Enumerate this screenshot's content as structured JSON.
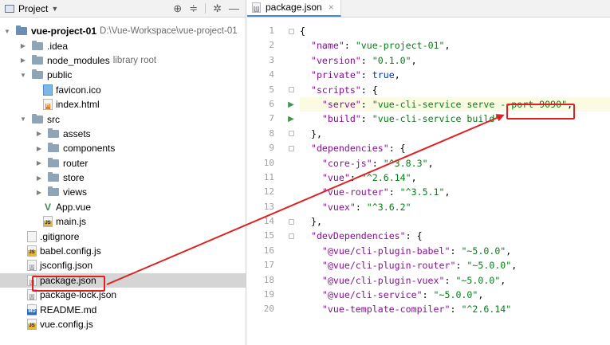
{
  "project_panel": {
    "title": "Project",
    "tools": [
      "target-icon",
      "collapse-all-icon",
      "gear-icon",
      "minimize-icon"
    ]
  },
  "tree": [
    {
      "label": "vue-project-01",
      "path": "D:\\Vue-Workspace\\vue-project-01",
      "type": "root",
      "depth": 0,
      "expanded": true,
      "bold": true
    },
    {
      "label": ".idea",
      "type": "folder",
      "depth": 1,
      "expanded": false
    },
    {
      "label": "node_modules",
      "path": "library root",
      "type": "folder",
      "depth": 1,
      "expanded": false
    },
    {
      "label": "public",
      "type": "folder",
      "depth": 1,
      "expanded": true
    },
    {
      "label": "favicon.ico",
      "type": "ico",
      "depth": 2
    },
    {
      "label": "index.html",
      "type": "html",
      "depth": 2
    },
    {
      "label": "src",
      "type": "folder",
      "depth": 1,
      "expanded": true
    },
    {
      "label": "assets",
      "type": "folder",
      "depth": 2,
      "expanded": false
    },
    {
      "label": "components",
      "type": "folder",
      "depth": 2,
      "expanded": false
    },
    {
      "label": "router",
      "type": "folder",
      "depth": 2,
      "expanded": false
    },
    {
      "label": "store",
      "type": "folder",
      "depth": 2,
      "expanded": false
    },
    {
      "label": "views",
      "type": "folder",
      "depth": 2,
      "expanded": false
    },
    {
      "label": "App.vue",
      "type": "vue",
      "depth": 2
    },
    {
      "label": "main.js",
      "type": "js",
      "depth": 2
    },
    {
      "label": ".gitignore",
      "type": "cfg",
      "depth": 1
    },
    {
      "label": "babel.config.js",
      "type": "js",
      "depth": 1
    },
    {
      "label": "jsconfig.json",
      "type": "json",
      "depth": 1
    },
    {
      "label": "package.json",
      "type": "json",
      "depth": 1,
      "selected": true
    },
    {
      "label": "package-lock.json",
      "type": "json",
      "depth": 1
    },
    {
      "label": "README.md",
      "type": "md",
      "depth": 1
    },
    {
      "label": "vue.config.js",
      "type": "js",
      "depth": 1
    }
  ],
  "editor": {
    "tab_label": "package.json",
    "lines": [
      [
        [
          "p",
          "{"
        ]
      ],
      [
        [
          "p",
          "  "
        ],
        [
          "k",
          "\"name\""
        ],
        [
          "p",
          ": "
        ],
        [
          "s",
          "\"vue-project-01\""
        ],
        [
          "p",
          ","
        ]
      ],
      [
        [
          "p",
          "  "
        ],
        [
          "k",
          "\"version\""
        ],
        [
          "p",
          ": "
        ],
        [
          "s",
          "\"0.1.0\""
        ],
        [
          "p",
          ","
        ]
      ],
      [
        [
          "p",
          "  "
        ],
        [
          "k",
          "\"private\""
        ],
        [
          "p",
          ": "
        ],
        [
          "b",
          "true"
        ],
        [
          "p",
          ","
        ]
      ],
      [
        [
          "p",
          "  "
        ],
        [
          "k",
          "\"scripts\""
        ],
        [
          "p",
          ": {"
        ]
      ],
      [
        [
          "p",
          "    "
        ],
        [
          "k",
          "\"serve\""
        ],
        [
          "p",
          ": "
        ],
        [
          "s",
          "\"vue-cli-service serve --port 9090\""
        ],
        [
          "p",
          ","
        ]
      ],
      [
        [
          "p",
          "    "
        ],
        [
          "k",
          "\"build\""
        ],
        [
          "p",
          ": "
        ],
        [
          "s",
          "\"vue-cli-service build\""
        ]
      ],
      [
        [
          "p",
          "  },"
        ]
      ],
      [
        [
          "p",
          "  "
        ],
        [
          "k",
          "\"dependencies\""
        ],
        [
          "p",
          ": {"
        ]
      ],
      [
        [
          "p",
          "    "
        ],
        [
          "k",
          "\"core-js\""
        ],
        [
          "p",
          ": "
        ],
        [
          "s",
          "\"^3.8.3\""
        ],
        [
          "p",
          ","
        ]
      ],
      [
        [
          "p",
          "    "
        ],
        [
          "k",
          "\"vue\""
        ],
        [
          "p",
          ": "
        ],
        [
          "s",
          "\"^2.6.14\""
        ],
        [
          "p",
          ","
        ]
      ],
      [
        [
          "p",
          "    "
        ],
        [
          "k",
          "\"vue-router\""
        ],
        [
          "p",
          ": "
        ],
        [
          "s",
          "\"^3.5.1\""
        ],
        [
          "p",
          ","
        ]
      ],
      [
        [
          "p",
          "    "
        ],
        [
          "k",
          "\"vuex\""
        ],
        [
          "p",
          ": "
        ],
        [
          "s",
          "\"^3.6.2\""
        ]
      ],
      [
        [
          "p",
          "  },"
        ]
      ],
      [
        [
          "p",
          "  "
        ],
        [
          "k",
          "\"devDependencies\""
        ],
        [
          "p",
          ": {"
        ]
      ],
      [
        [
          "p",
          "    "
        ],
        [
          "k",
          "\"@vue/cli-plugin-babel\""
        ],
        [
          "p",
          ": "
        ],
        [
          "s",
          "\"~5.0.0\""
        ],
        [
          "p",
          ","
        ]
      ],
      [
        [
          "p",
          "    "
        ],
        [
          "k",
          "\"@vue/cli-plugin-router\""
        ],
        [
          "p",
          ": "
        ],
        [
          "s",
          "\"~5.0.0\""
        ],
        [
          "p",
          ","
        ]
      ],
      [
        [
          "p",
          "    "
        ],
        [
          "k",
          "\"@vue/cli-plugin-vuex\""
        ],
        [
          "p",
          ": "
        ],
        [
          "s",
          "\"~5.0.0\""
        ],
        [
          "p",
          ","
        ]
      ],
      [
        [
          "p",
          "    "
        ],
        [
          "k",
          "\"@vue/cli-service\""
        ],
        [
          "p",
          ": "
        ],
        [
          "s",
          "\"~5.0.0\""
        ],
        [
          "p",
          ","
        ]
      ],
      [
        [
          "p",
          "    "
        ],
        [
          "k",
          "\"vue-template-compiler\""
        ],
        [
          "p",
          ": "
        ],
        [
          "s",
          "\"^2.6.14\""
        ]
      ]
    ],
    "line_numbers": [
      "1",
      "2",
      "3",
      "4",
      "5",
      "6",
      "7",
      "8",
      "9",
      "10",
      "11",
      "12",
      "13",
      "14",
      "15",
      "16",
      "17",
      "18",
      "19",
      "20"
    ],
    "run_lines": [
      6,
      7
    ],
    "fold_lines": [
      1,
      5,
      8,
      9,
      14,
      15
    ]
  },
  "colors": {
    "annotation": "#e02020",
    "selection": "#d5d5d5",
    "string": "#067d17",
    "key": "#871094",
    "boolean": "#0033b3"
  }
}
